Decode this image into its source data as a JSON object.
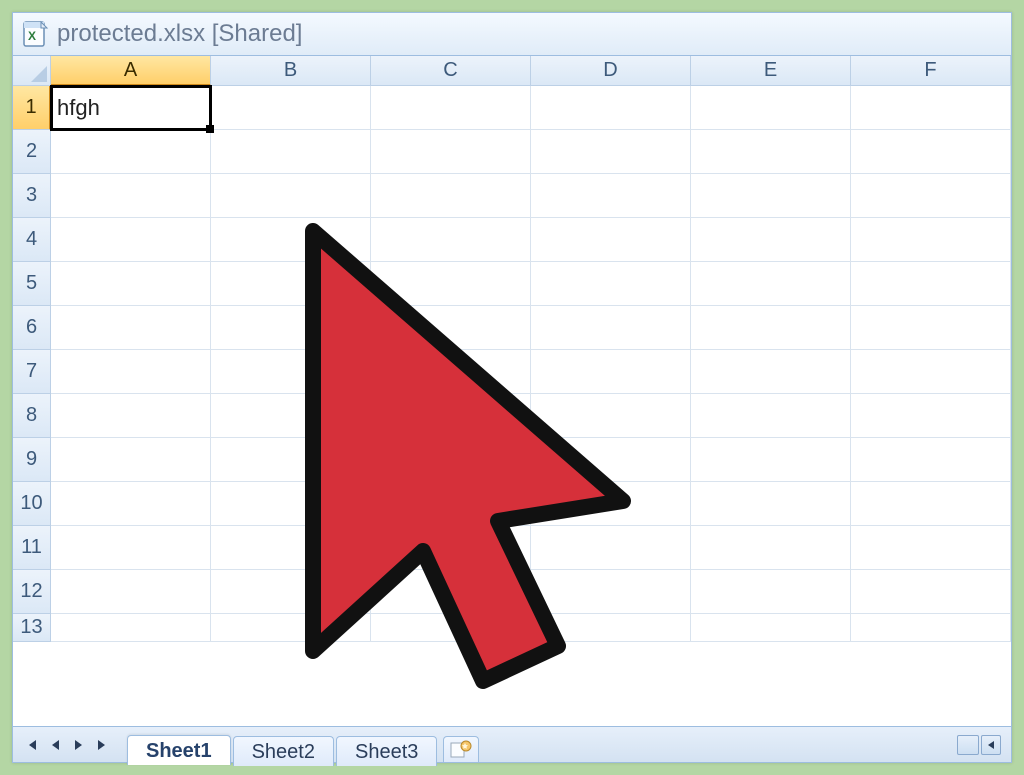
{
  "window": {
    "title": "protected.xlsx  [Shared]"
  },
  "columns": [
    "A",
    "B",
    "C",
    "D",
    "E",
    "F"
  ],
  "active_column_index": 0,
  "rows": [
    "1",
    "2",
    "3",
    "4",
    "5",
    "6",
    "7",
    "8",
    "9",
    "10",
    "11",
    "12",
    "13"
  ],
  "active_row_index": 0,
  "selected_cell": {
    "col": "A",
    "row": "1",
    "value": "hfgh"
  },
  "sheet_tabs": [
    "Sheet1",
    "Sheet2",
    "Sheet3"
  ],
  "active_sheet_index": 0,
  "cursor_icon_name": "mouse-pointer-icon",
  "colors": {
    "frame": "#b4d6a4",
    "cursor_fill": "#d6303a",
    "cursor_stroke": "#111"
  }
}
